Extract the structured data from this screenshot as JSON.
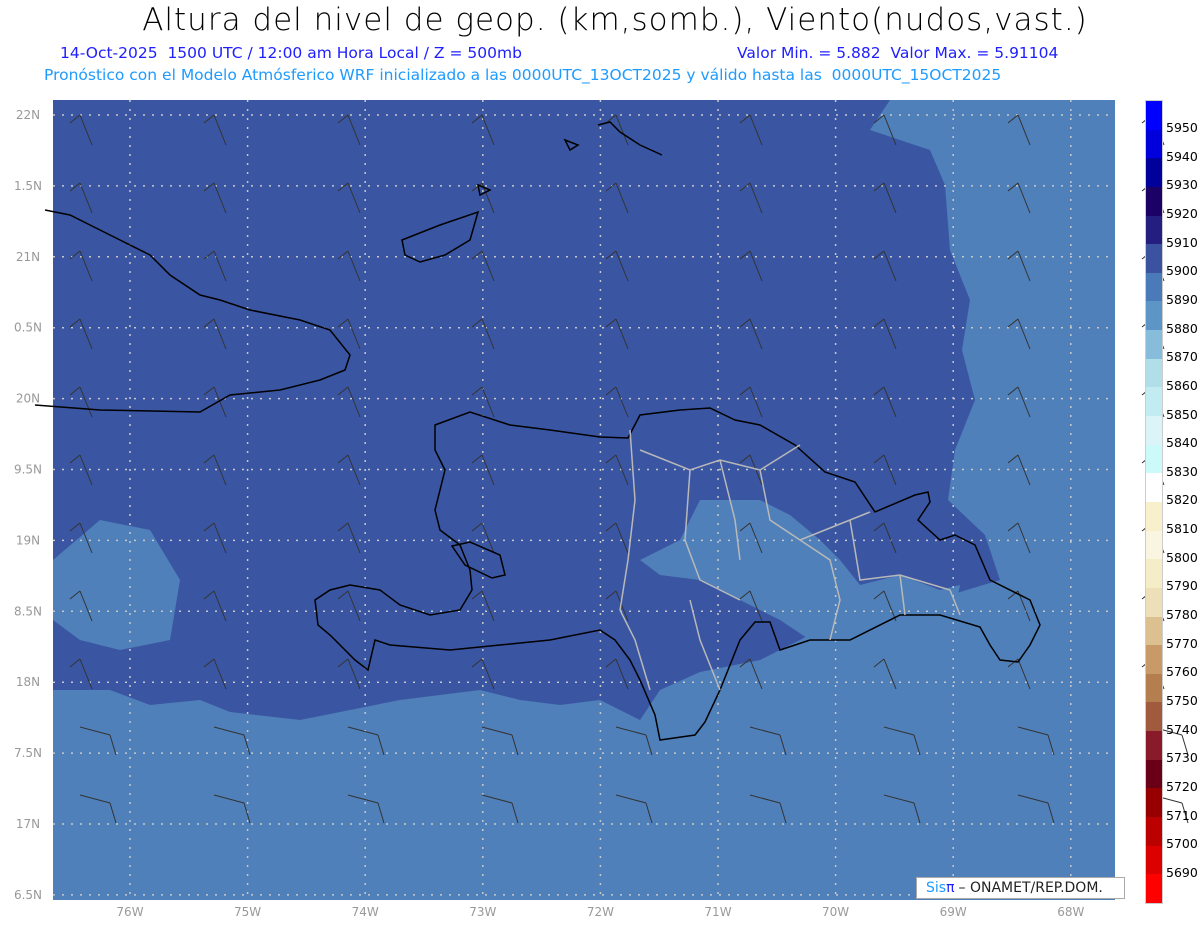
{
  "header": {
    "title": "Altura del nivel de geop. (km,somb.), Viento(nudos,vast.)",
    "info": "14-Oct-2025  1500 UTC / 12:00 am Hora Local / Z = 500mb",
    "minmax": "Valor Min. = 5.882  Valor Max. = 5.91104",
    "forecast": "Pronóstico con el Modelo Atmósferico WRF inicializado a las 0000UTC_13OCT2025 y válido hasta las  0000UTC_15OCT2025"
  },
  "axes": {
    "lon_labels": [
      "76W",
      "75W",
      "74W",
      "73W",
      "72W",
      "71W",
      "70W",
      "69W",
      "68W"
    ],
    "lat_labels": [
      "22N",
      "1.5N",
      "21N",
      "0.5N",
      "20N",
      "9.5N",
      "19N",
      "8.5N",
      "18N",
      "7.5N",
      "17N",
      "6.5N"
    ]
  },
  "colorbar": {
    "labels": [
      "5950",
      "5940",
      "5930",
      "5920",
      "5910",
      "5900",
      "5890",
      "5880",
      "5870",
      "5860",
      "5850",
      "5840",
      "5830",
      "5820",
      "5810",
      "5800",
      "5790",
      "5780",
      "5770",
      "5760",
      "5750",
      "5740",
      "5730",
      "5720",
      "5710",
      "5700",
      "5690"
    ],
    "colors": [
      "#0000ff",
      "#0000dd",
      "#00009a",
      "#1b0066",
      "#231e80",
      "#3a52a0",
      "#4a7ab8",
      "#5c95c6",
      "#88bcdb",
      "#b0dfea",
      "#c3ebf2",
      "#daf4f8",
      "#ccf9fa",
      "#ffffff",
      "#f8f0cc",
      "#faf5e0",
      "#f5ecc8",
      "#ede0b8",
      "#dcc090",
      "#c89a68",
      "#b57e4e",
      "#a05a3e",
      "#881a2a",
      "#6a0018",
      "#960000",
      "#bb0000",
      "#dd0000",
      "#ff0000"
    ]
  },
  "map_colors": {
    "dark": "#3a56a3",
    "light": "#4f80ba"
  },
  "logo": {
    "sis": "Sis",
    "pi": "π",
    "org": "– ONAMET/REP.DOM."
  }
}
